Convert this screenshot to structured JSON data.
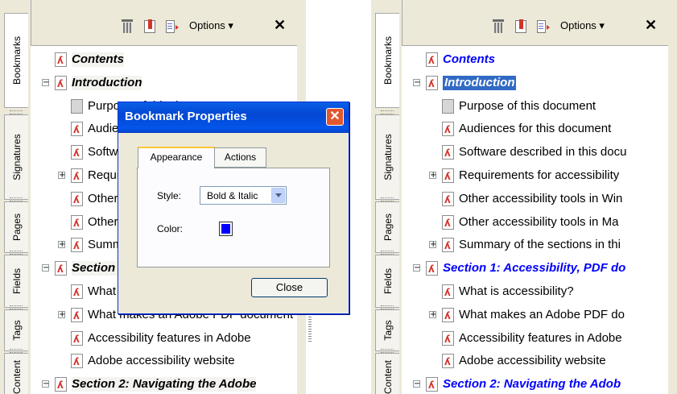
{
  "sidebar_tabs": [
    "Bookmarks",
    "Signatures",
    "Pages",
    "Fields",
    "Tags",
    "Content"
  ],
  "toolbar": {
    "options_label": "Options ▾",
    "close_label": "✕"
  },
  "left_panel": {
    "bookmarks": [
      {
        "label": "Contents",
        "style": "bold-italic",
        "expander": ""
      },
      {
        "label": "Introduction",
        "style": "bold-italic",
        "expander": "−"
      },
      {
        "label": "Purpose of this document",
        "style": "normal",
        "expander": "",
        "icon": "gray"
      },
      {
        "label": "Audiences for this document",
        "style": "normal",
        "expander": ""
      },
      {
        "label": "Software described in this document",
        "style": "normal",
        "expander": ""
      },
      {
        "label": "Requirements for accessibility",
        "style": "normal",
        "expander": "+"
      },
      {
        "label": "Other accessibility tools in Windows",
        "style": "normal",
        "expander": ""
      },
      {
        "label": "Other accessibility tools in Mac OS",
        "style": "normal",
        "expander": ""
      },
      {
        "label": "Summary of the sections in this document",
        "style": "normal",
        "expander": "+"
      },
      {
        "label": "Section 1: Accessibility, PDF documents",
        "style": "bold-italic",
        "expander": "−"
      },
      {
        "label": "What is accessibility?",
        "style": "normal",
        "expander": ""
      },
      {
        "label": "What makes an Adobe PDF document",
        "style": "normal",
        "expander": "+"
      },
      {
        "label": "Accessibility features in Adobe",
        "style": "normal",
        "expander": ""
      },
      {
        "label": "Adobe accessibility website",
        "style": "normal",
        "expander": ""
      },
      {
        "label": "Section 2: Navigating the Adobe",
        "style": "bold-italic",
        "expander": "−"
      }
    ]
  },
  "right_panel": {
    "bookmarks": [
      {
        "label": "Contents",
        "style": "blue-bold-italic",
        "expander": ""
      },
      {
        "label": "Introduction",
        "style": "selected",
        "expander": "−"
      },
      {
        "label": "Purpose of this document",
        "style": "normal",
        "expander": "",
        "icon": "gray"
      },
      {
        "label": "Audiences for this document",
        "style": "normal",
        "expander": ""
      },
      {
        "label": "Software described in this docu",
        "style": "normal",
        "expander": ""
      },
      {
        "label": "Requirements for accessibility",
        "style": "normal",
        "expander": "+"
      },
      {
        "label": "Other accessibility tools in Win",
        "style": "normal",
        "expander": ""
      },
      {
        "label": "Other accessibility tools in Ma",
        "style": "normal",
        "expander": ""
      },
      {
        "label": "Summary of the sections in thi",
        "style": "normal",
        "expander": "+"
      },
      {
        "label": "Section 1: Accessibility, PDF do",
        "style": "blue-bold-italic",
        "expander": "−"
      },
      {
        "label": "What is accessibility?",
        "style": "normal",
        "expander": ""
      },
      {
        "label": "What makes an Adobe PDF do",
        "style": "normal",
        "expander": "+"
      },
      {
        "label": "Accessibility features in Adobe",
        "style": "normal",
        "expander": ""
      },
      {
        "label": "Adobe accessibility website",
        "style": "normal",
        "expander": ""
      },
      {
        "label": "Section 2: Navigating the Adob",
        "style": "blue-bold-italic",
        "expander": "−"
      }
    ]
  },
  "dialog": {
    "title": "Bookmark Properties",
    "close_glyph": "✕",
    "tabs": [
      "Appearance",
      "Actions"
    ],
    "active_tab": "Appearance",
    "style_label": "Style:",
    "style_value": "Bold & Italic",
    "color_label": "Color:",
    "color_value": "#0000ff",
    "close_button": "Close"
  },
  "colors": {
    "panel_bg": "#ece9d8",
    "titlebar_blue": "#0347d3",
    "selection": "#316ac5",
    "bookmark_blue": "#0000ff",
    "pdf_red": "#d2352b"
  }
}
